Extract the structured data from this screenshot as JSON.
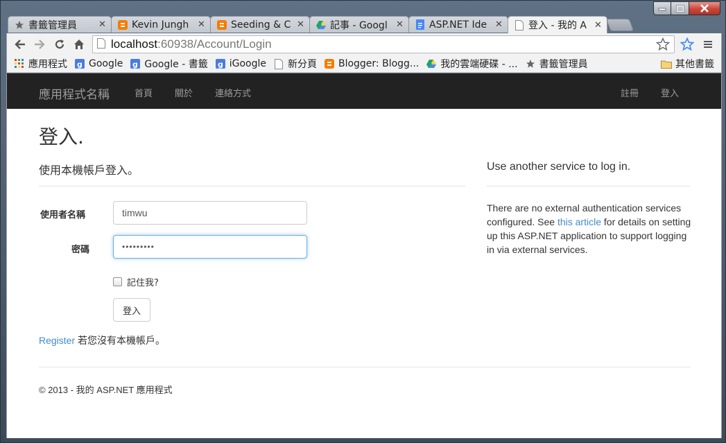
{
  "browser": {
    "tabs": [
      {
        "title": "書籤管理員",
        "icon": "star-icon"
      },
      {
        "title": "Kevin Jungh",
        "icon": "blogger-icon"
      },
      {
        "title": "Seeding & C",
        "icon": "blogger-icon"
      },
      {
        "title": "記事 - Googl",
        "icon": "drive-icon"
      },
      {
        "title": "ASP.NET Ide",
        "icon": "docs-icon"
      },
      {
        "title": "登入 - 我的 A",
        "icon": "page-icon"
      }
    ],
    "address": {
      "host": "localhost",
      "path": ":60938/Account/Login"
    },
    "bookmarks": [
      {
        "label": "應用程式",
        "icon": "apps-icon"
      },
      {
        "label": "Google",
        "icon": "google-icon"
      },
      {
        "label": "Google - 書籤",
        "icon": "google-icon"
      },
      {
        "label": "iGoogle",
        "icon": "google-icon"
      },
      {
        "label": "新分頁",
        "icon": "page-icon"
      },
      {
        "label": "Blogger: Blogg...",
        "icon": "blogger-icon"
      },
      {
        "label": "我的雲端硬碟 - ...",
        "icon": "drive-icon"
      },
      {
        "label": "書籤管理員",
        "icon": "star-icon"
      }
    ],
    "other_bookmarks": "其他書籤"
  },
  "navbar": {
    "brand": "應用程式名稱",
    "links": [
      "首頁",
      "關於",
      "連絡方式"
    ],
    "right_links": [
      "註冊",
      "登入"
    ]
  },
  "page": {
    "title": "登入.",
    "local_heading": "使用本機帳戶登入。",
    "username_label": "使用者名稱",
    "username_value": "timwu",
    "password_label": "密碼",
    "password_value": "•••••••••",
    "remember_label": "記住我?",
    "submit_label": "登入",
    "register_link": "Register",
    "register_text": " 若您沒有本機帳戶。",
    "external_heading": "Use another service to log in.",
    "external_text_1": "There are no external authentication services configured. See ",
    "external_link": "this article",
    "external_text_2": " for details on setting up this ASP.NET application to support logging in via external services.",
    "footer": "© 2013 - 我的 ASP.NET 應用程式"
  },
  "colors": {
    "navbar_bg": "#222222",
    "link": "#428bca",
    "focus": "#66afe9"
  }
}
